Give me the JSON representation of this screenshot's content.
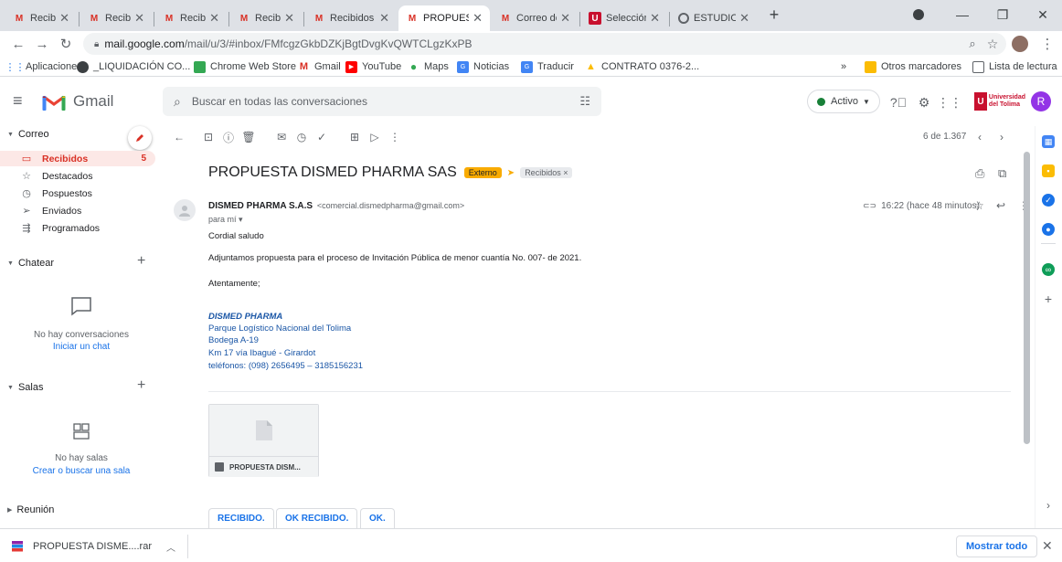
{
  "browser": {
    "tabs": [
      {
        "label": "Recibidos (",
        "favicon": "gmail-icon"
      },
      {
        "label": "Recibidos (",
        "favicon": "gmail-icon"
      },
      {
        "label": "Recibidos (",
        "favicon": "gmail-icon"
      },
      {
        "label": "Recibidos (",
        "favicon": "gmail-icon"
      },
      {
        "label": "Recibidos (",
        "favicon": "gmail-icon"
      },
      {
        "label": "PROPUEST",
        "favicon": "gmail-icon",
        "active": true
      },
      {
        "label": "Correo de",
        "favicon": "gmail-icon"
      },
      {
        "label": "Selección",
        "favicon": "university-icon"
      },
      {
        "label": "ESTUDIOS",
        "favicon": "chrome-icon"
      }
    ],
    "url_host": "mail.google.com",
    "url_path": "/mail/u/3/#inbox/FMfcgzGkbDZKjBgtDvgKvQWTCLgzKxPB",
    "bookmarks": [
      {
        "label": "Aplicaciones",
        "icon": "apps-icon"
      },
      {
        "label": "_LIQUIDACIÓN CO...",
        "icon": "chrome-icon"
      },
      {
        "label": "Chrome Web Store",
        "icon": "webstore-icon"
      },
      {
        "label": "Gmail",
        "icon": "gmail-icon"
      },
      {
        "label": "YouTube",
        "icon": "youtube-icon"
      },
      {
        "label": "Maps",
        "icon": "maps-icon"
      },
      {
        "label": "Noticias",
        "icon": "news-icon"
      },
      {
        "label": "Traducir",
        "icon": "translate-icon"
      },
      {
        "label": "CONTRATO 0376-2...",
        "icon": "drive-icon"
      }
    ],
    "bookmarks_more": "»",
    "other_bookmarks": "Otros marcadores",
    "reading_list": "Lista de lectura"
  },
  "gmail": {
    "app_name": "Gmail",
    "search_placeholder": "Buscar en todas las conversaciones",
    "status": "Activo",
    "avatar_letter": "R",
    "org_logo_line1": "Universidad",
    "org_logo_line2": "del Tolima",
    "org_logo_letter": "U"
  },
  "sidebar": {
    "mail_section": "Correo",
    "items": [
      {
        "label": "Recibidos",
        "count": "5",
        "icon": "inbox-icon",
        "active": true
      },
      {
        "label": "Destacados",
        "count": "",
        "icon": "star-icon"
      },
      {
        "label": "Pospuestos",
        "count": "",
        "icon": "clock-icon"
      },
      {
        "label": "Enviados",
        "count": "",
        "icon": "send-icon"
      },
      {
        "label": "Programados",
        "count": "",
        "icon": "scheduled-icon"
      }
    ],
    "chat_section": "Chatear",
    "chat_empty": "No hay conversaciones",
    "chat_link": "Iniciar un chat",
    "rooms_section": "Salas",
    "rooms_empty": "No hay salas",
    "rooms_link": "Crear o buscar una sala",
    "meet_section": "Reunión"
  },
  "toolbar": {
    "page_count": "6 de 1.367"
  },
  "message": {
    "subject": "PROPUESTA DISMED PHARMA SAS",
    "label_external": "Externo",
    "label_inbox": "Recibidos ×",
    "sender_name": "DISMED PHARMA S.A.S",
    "sender_email": "<comercial.dismedpharma@gmail.com>",
    "to": "para mí ▾",
    "time": "16:22 (hace 48 minutos)",
    "greeting": "Cordial saludo",
    "body": "Adjuntamos propuesta para el proceso de Invitación Pública de menor cuantía No. 007- de 2021.",
    "closing": "Atentamente;",
    "signature": [
      "DISMED PHARMA",
      "Parque Logístico Nacional del Tolima",
      "Bodega A-19",
      "Km 17 vía Ibagué - Girardot",
      "teléfonos: (098) 2656495 – 3185156231"
    ],
    "attachment_name": "PROPUESTA DISM...",
    "smart_replies": [
      "RECIBIDO.",
      "OK RECIBIDO.",
      "OK."
    ]
  },
  "downloads": {
    "file": "PROPUESTA DISME....rar",
    "show_all": "Mostrar todo"
  },
  "colors": {
    "gmail_red": "#d93025",
    "link_blue": "#1a73e8",
    "label_orange": "#f9ab00",
    "active_green": "#188038"
  }
}
